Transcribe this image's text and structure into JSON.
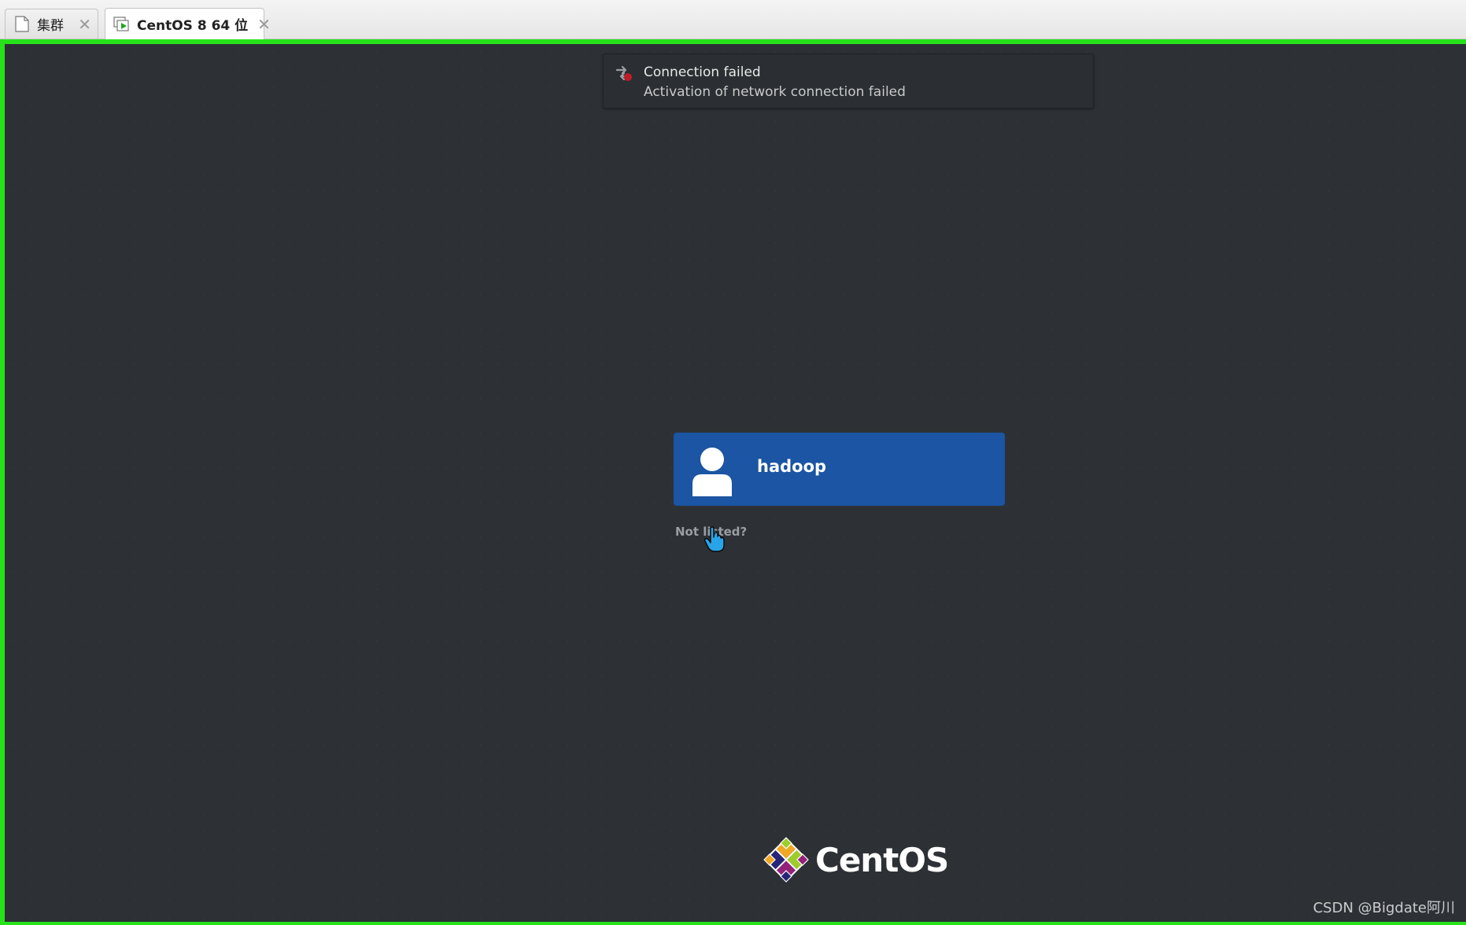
{
  "tabs": [
    {
      "label": "集群",
      "icon": "document-icon",
      "active": false,
      "close": "✕"
    },
    {
      "label": "CentOS 8 64 位",
      "icon": "vm-running-icon",
      "active": true,
      "close": "✕"
    }
  ],
  "notification": {
    "title": "Connection failed",
    "body": "Activation of network connection failed",
    "icon": "network-error-icon"
  },
  "login": {
    "user_name": "hadoop",
    "avatar_icon": "user-avatar-icon",
    "not_listed": "Not listed?"
  },
  "brand": {
    "logo_text": "CentOS"
  },
  "watermark": "CSDN @Bigdate阿川",
  "colors": {
    "vm_border": "#27e21b",
    "desktop_bg": "#2d3136",
    "user_card": "#1b55a3"
  }
}
